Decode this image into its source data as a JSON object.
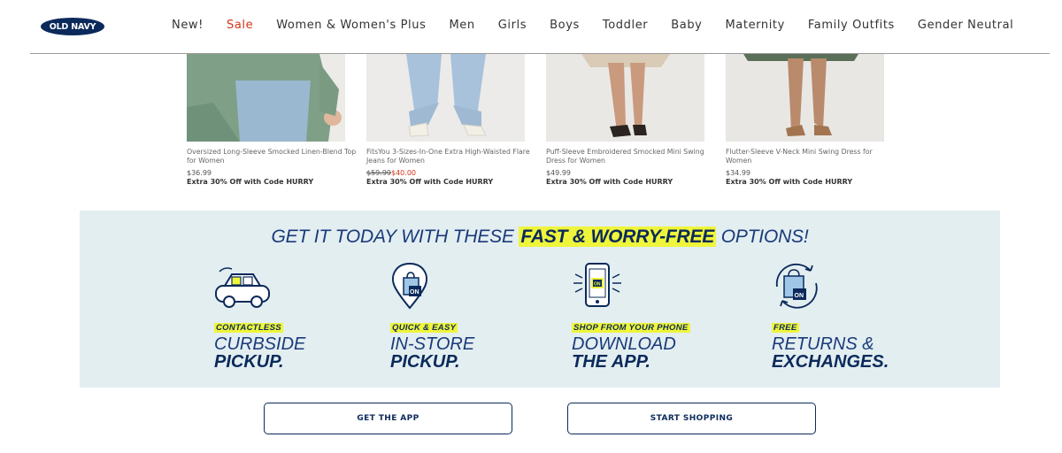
{
  "header": {
    "logo_text": "OLD NAVY",
    "nav": [
      "New!",
      "Sale",
      "Women & Women's Plus",
      "Men",
      "Girls",
      "Boys",
      "Toddler",
      "Baby",
      "Maternity",
      "Family Outfits",
      "Gender Neutral"
    ]
  },
  "products": [
    {
      "name": "Oversized Long-Sleeve Smocked Linen-Blend Top for Women",
      "price": "$36.99",
      "promo": "Extra 30% Off with Code HURRY"
    },
    {
      "name": "FitsYou 3-Sizes-In-One Extra High-Waisted Flare Jeans for Women",
      "original_price": "$59.99",
      "sale_price": "$40.00",
      "promo": "Extra 30% Off with Code HURRY"
    },
    {
      "name": "Puff-Sleeve Embroidered Smocked Mini Swing Dress for Women",
      "price": "$49.99",
      "promo": "Extra 30% Off with Code HURRY"
    },
    {
      "name": "Flutter-Sleeve V-Neck Mini Swing Dress for Women",
      "price": "$34.99",
      "promo": "Extra 30% Off with Code HURRY"
    }
  ],
  "banner": {
    "headline_pre": "GET IT TODAY WITH THESE",
    "headline_highlight": "FAST & WORRY-FREE",
    "headline_post": "OPTIONS!",
    "options": [
      {
        "tag": "CONTACTLESS",
        "line1": "CURBSIDE",
        "line2": "PICKUP.",
        "icon": "car-icon"
      },
      {
        "tag": "QUICK & EASY",
        "line1": "IN-STORE",
        "line2": "PICKUP.",
        "icon": "store-pin-icon"
      },
      {
        "tag": "SHOP FROM YOUR PHONE",
        "line1": "DOWNLOAD",
        "line2": "THE APP.",
        "icon": "phone-icon"
      },
      {
        "tag": "FREE",
        "line1": "RETURNS &",
        "line2": "EXCHANGES.",
        "icon": "returns-bag-icon"
      }
    ]
  },
  "buttons": {
    "get_app": "GET THE APP",
    "start_shopping": "START SHOPPING"
  },
  "colors": {
    "navy": "#0b2a5b",
    "sale_red": "#d6341a",
    "highlight_yellow": "#eff53a",
    "banner_bg": "#e3eef1"
  }
}
